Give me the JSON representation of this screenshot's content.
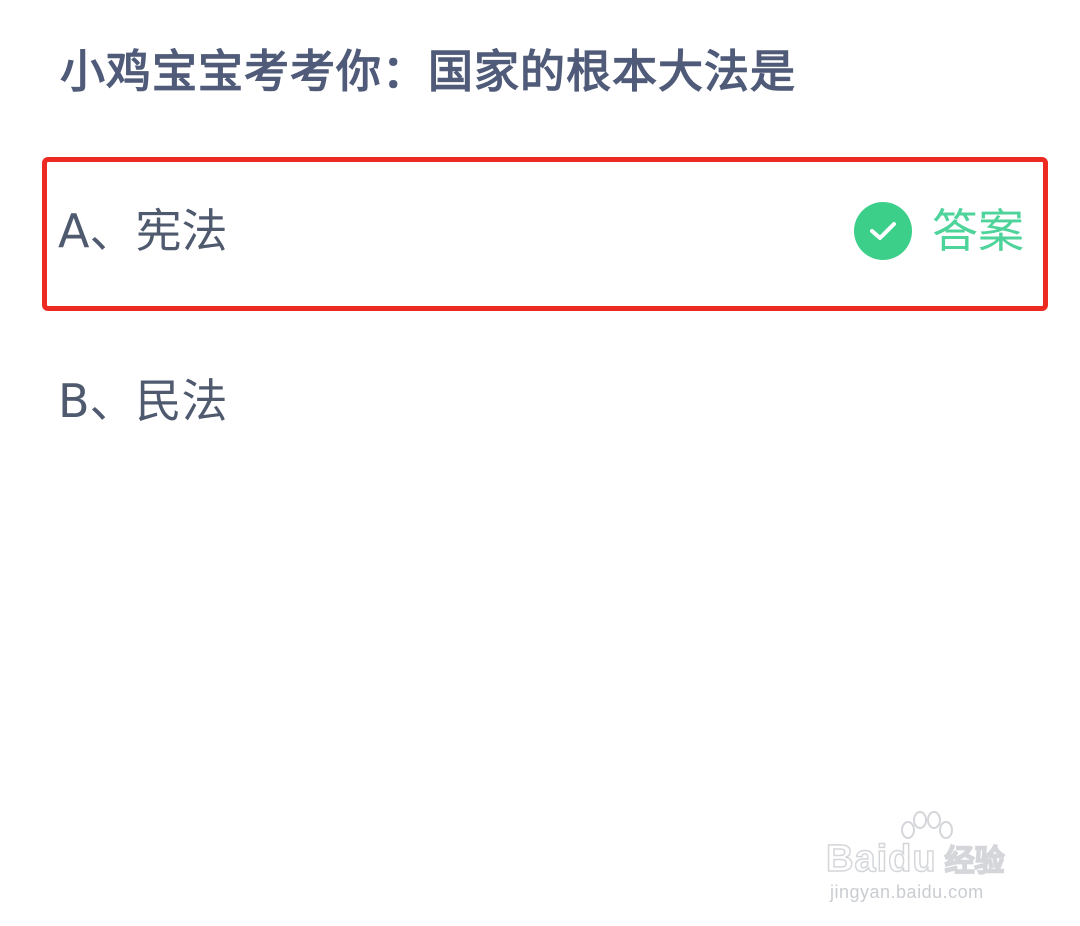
{
  "question": {
    "title": "小鸡宝宝考考你：国家的根本大法是"
  },
  "options": [
    {
      "label": "A、宪法",
      "is_answer": true,
      "answer_tag": "答案",
      "answer_icon": "check-circle-icon"
    },
    {
      "label": "B、民法",
      "is_answer": false
    }
  ],
  "watermark": {
    "brand": "Baidu",
    "product": "经验",
    "url": "jingyan.baidu.com",
    "icon": "paw-icon"
  },
  "colors": {
    "title": "#4f5b78",
    "option_text": "#4f5a6e",
    "answer_green": "#4ed39a",
    "check_green": "#3ccf8a",
    "highlight_red": "#ec2a22",
    "background": "#ffffff"
  }
}
